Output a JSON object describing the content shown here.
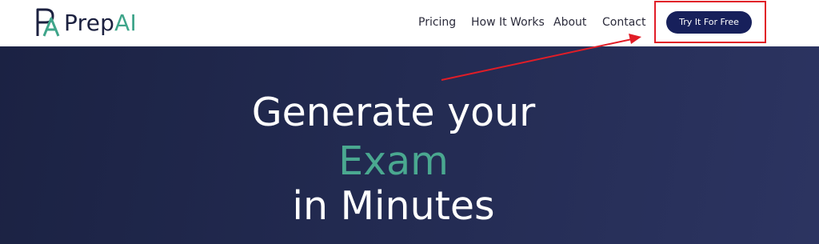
{
  "logo": {
    "text_main": "Prep",
    "text_accent": "AI",
    "colors": {
      "main": "#1c2140",
      "accent": "#3fa58a"
    }
  },
  "nav": {
    "items": [
      {
        "label": "Pricing"
      },
      {
        "label": "How It Works"
      },
      {
        "label": "About"
      },
      {
        "label": "Contact"
      }
    ]
  },
  "cta": {
    "label": "Try It For Free",
    "color": "#17205b",
    "highlight_color": "#e11d27"
  },
  "hero": {
    "line1": "Generate your",
    "line2": "Exam",
    "line3": "in Minutes",
    "colors": {
      "background": "#232b52",
      "text": "#ffffff",
      "accent": "#4aa890"
    }
  },
  "annotation": {
    "arrow_color": "#e11d27"
  }
}
